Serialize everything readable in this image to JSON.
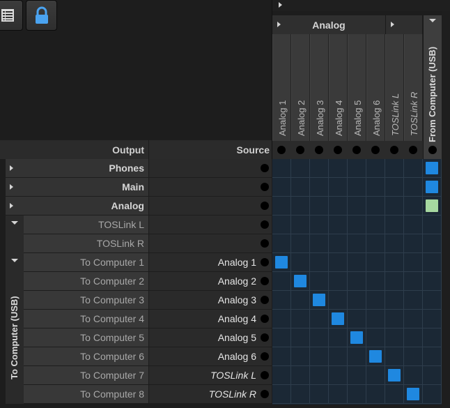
{
  "toolbar": {
    "list_icon": "list-icon",
    "lock_icon": "lock-icon"
  },
  "columns": {
    "group_label": "Analog",
    "items": [
      {
        "label": "Analog 1",
        "italic": false
      },
      {
        "label": "Analog 2",
        "italic": false
      },
      {
        "label": "Analog 3",
        "italic": false
      },
      {
        "label": "Analog 4",
        "italic": false
      },
      {
        "label": "Analog 5",
        "italic": false
      },
      {
        "label": "Analog 6",
        "italic": false
      },
      {
        "label": "TOSLink L",
        "italic": true
      },
      {
        "label": "TOSLink R",
        "italic": true
      }
    ],
    "usb_label": "From Computer (USB)"
  },
  "headers": {
    "output": "Output",
    "source": "Source"
  },
  "rows": {
    "groups": [
      {
        "label": "Phones",
        "expanded": false,
        "cell": "blue"
      },
      {
        "label": "Main",
        "expanded": false,
        "cell": "blue"
      },
      {
        "label": "Analog",
        "expanded": false,
        "cell": "green"
      }
    ],
    "toslink": [
      {
        "label": "TOSLink L",
        "source": ""
      },
      {
        "label": "TOSLink R",
        "source": ""
      }
    ],
    "usb_group_label": "To Computer (USB)",
    "usb": [
      {
        "label": "To Computer 1",
        "source": "Analog 1",
        "italic": false,
        "col": 0
      },
      {
        "label": "To Computer 2",
        "source": "Analog 2",
        "italic": false,
        "col": 1
      },
      {
        "label": "To Computer 3",
        "source": "Analog 3",
        "italic": false,
        "col": 2
      },
      {
        "label": "To Computer 4",
        "source": "Analog 4",
        "italic": false,
        "col": 3
      },
      {
        "label": "To Computer 5",
        "source": "Analog 5",
        "italic": false,
        "col": 4
      },
      {
        "label": "To Computer 6",
        "source": "Analog 6",
        "italic": false,
        "col": 5
      },
      {
        "label": "To Computer 7",
        "source": "TOSLink L",
        "italic": true,
        "col": 6
      },
      {
        "label": "To Computer 8",
        "source": "TOSLink R",
        "italic": true,
        "col": 7
      }
    ]
  },
  "colors": {
    "blue": "#1f88e0",
    "green": "#a6d8a0",
    "grid_bg": "#1b2835",
    "grid_line": "#2e3d4c"
  }
}
